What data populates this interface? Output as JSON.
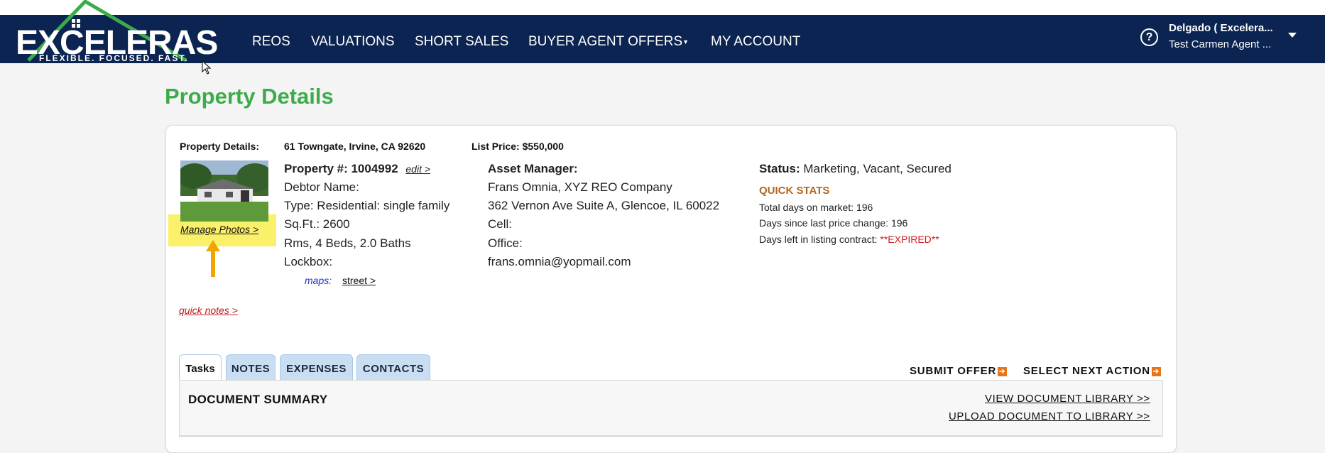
{
  "brand": {
    "name": "EXCELERAS",
    "tagline": "FLEXIBLE. FOCUSED. FAST."
  },
  "nav": {
    "items": [
      "REOS",
      "VALUATIONS",
      "SHORT SALES",
      "BUYER AGENT OFFERS",
      "MY ACCOUNT"
    ],
    "help_label": "?"
  },
  "user": {
    "name": "Delgado ( Excelera...",
    "subtitle": "Test Carmen Agent ..."
  },
  "page": {
    "title": "Property Details"
  },
  "property": {
    "header_label": "Property Details:",
    "address": "61 Towngate, Irvine, CA 92620",
    "list_price": "List Price: $550,000",
    "manage_photos": "Manage Photos >",
    "number_label": "Property #: 1004992",
    "edit_link": "edit >",
    "debtor": "Debtor Name:",
    "type": "Type: Residential: single family",
    "sqft": "Sq.Ft.: 2600",
    "rooms": "Rms, 4 Beds, 2.0 Baths",
    "lockbox": "Lockbox:",
    "maps_label": "maps:",
    "street_link": "street >",
    "quick_notes": "quick notes > "
  },
  "asset_manager": {
    "label": "Asset Manager:",
    "company": "Frans Omnia, XYZ REO Company",
    "address": "362 Vernon Ave Suite A, Glencoe, IL 60022",
    "cell": "Cell:",
    "office": "Office:",
    "email": "frans.omnia@yopmail.com"
  },
  "status": {
    "label": "Status:",
    "value": "Marketing, Vacant, Secured",
    "quick_stats_label": "QUICK STATS",
    "days_on_market": "Total days on market: 196",
    "days_since_price_change": "Days since last price change: 196",
    "days_left_label": "Days left in listing contract:",
    "days_left_value": "**EXPIRED**"
  },
  "tabs": [
    "Tasks",
    "NOTES",
    "EXPENSES",
    "CONTACTS"
  ],
  "actions": {
    "submit_offer": "SUBMIT OFFER",
    "select_next_action": "SELECT NEXT ACTION"
  },
  "documents": {
    "title": "DOCUMENT SUMMARY",
    "view_library": "VIEW DOCUMENT LIBRARY >>",
    "upload_library": "UPLOAD DOCUMENT TO LIBRARY >>"
  },
  "colors": {
    "navbar": "#0b2451",
    "title_green": "#3cac4b",
    "accent_orange": "#e8751a",
    "expired_red": "#d01d1d",
    "highlight_yellow": "#fbf06a"
  }
}
